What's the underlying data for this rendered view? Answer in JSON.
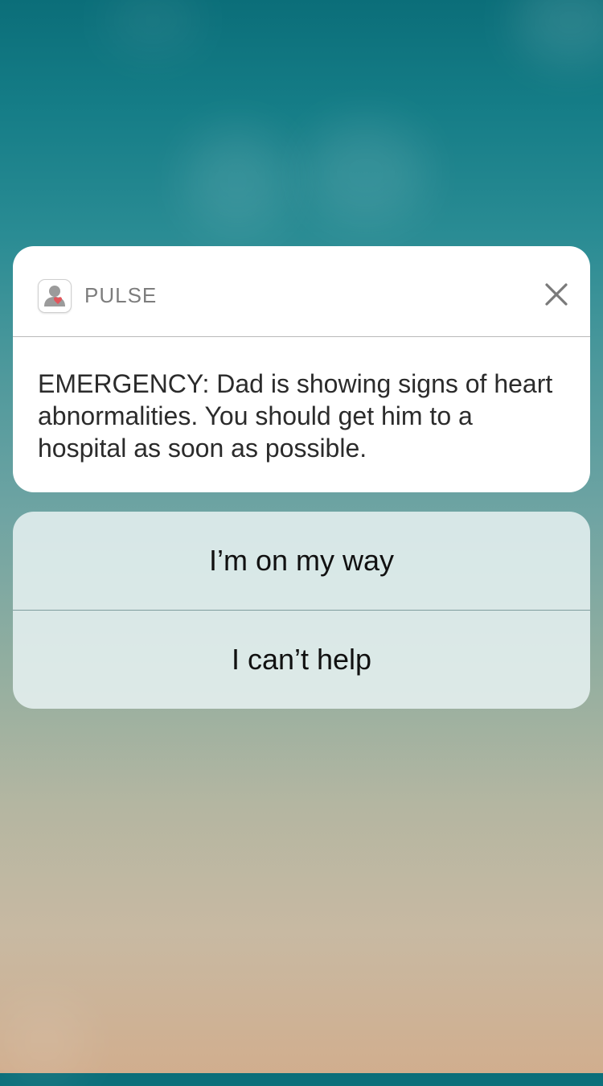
{
  "notification": {
    "app_name": "PULSE",
    "app_icon": "person-heart-icon",
    "close_icon": "close-icon",
    "message": "EMERGENCY: Dad is showing signs of heart abnormalities. You should get him to a hospital as soon as possible."
  },
  "actions": [
    {
      "label": "I’m on my way"
    },
    {
      "label": "I can’t help"
    }
  ],
  "colors": {
    "card_background": "#ffffff",
    "heart_accent": "#e2555b",
    "wallpaper_top": "#0b6e79",
    "wallpaper_bottom": "#d1ae8e"
  }
}
